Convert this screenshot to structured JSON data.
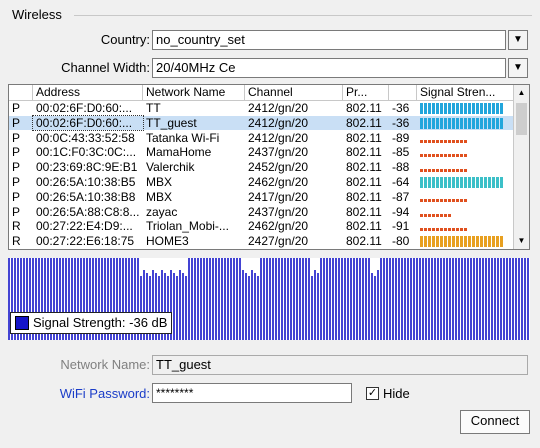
{
  "group": {
    "title": "Wireless"
  },
  "country": {
    "label": "Country:",
    "value": "no_country_set"
  },
  "channel_width": {
    "label": "Channel Width:",
    "value": "20/40MHz Ce"
  },
  "table": {
    "columns": [
      "",
      "Address",
      "Network Name",
      "Channel",
      "Pr...",
      "",
      "Signal Stren..."
    ],
    "rows": [
      {
        "type": "P",
        "address": "00:02:6F:D0:60:...",
        "network": "TT",
        "channel": "2412/gn/20",
        "protocol": "802.11",
        "signal": "-36",
        "selected": false,
        "bars": 100,
        "color": "#22a6dc"
      },
      {
        "type": "P",
        "address": "00:02:6F:D0:60:...",
        "network": "TT_guest",
        "channel": "2412/gn/20",
        "protocol": "802.11",
        "signal": "-36",
        "selected": true,
        "bars": 100,
        "color": "#22a6dc"
      },
      {
        "type": "P",
        "address": "00:0C:43:33:52:58",
        "network": "Tatanka Wi-Fi",
        "channel": "2412/gn/20",
        "protocol": "802.11",
        "signal": "-89",
        "selected": false,
        "bars": 55,
        "color": "#e0501e"
      },
      {
        "type": "P",
        "address": "00:1C:F0:3C:0C:...",
        "network": "MamaHome",
        "channel": "2437/gn/20",
        "protocol": "802.11",
        "signal": "-85",
        "selected": false,
        "bars": 55,
        "color": "#e0501e"
      },
      {
        "type": "P",
        "address": "00:23:69:8C:9E:B1",
        "network": "Valerchik",
        "channel": "2452/gn/20",
        "protocol": "802.11",
        "signal": "-88",
        "selected": false,
        "bars": 55,
        "color": "#e0501e"
      },
      {
        "type": "P",
        "address": "00:26:5A:10:38:B5",
        "network": "MBX",
        "channel": "2462/gn/20",
        "protocol": "802.11",
        "signal": "-64",
        "selected": false,
        "bars": 100,
        "color": "#3cc0c8"
      },
      {
        "type": "P",
        "address": "00:26:5A:10:38:B8",
        "network": "MBX",
        "channel": "2417/gn/20",
        "protocol": "802.11",
        "signal": "-87",
        "selected": false,
        "bars": 55,
        "color": "#e0501e"
      },
      {
        "type": "P",
        "address": "00:26:5A:88:C8:8...",
        "network": "zayac",
        "channel": "2437/gn/20",
        "protocol": "802.11",
        "signal": "-94",
        "selected": false,
        "bars": 40,
        "color": "#e0501e"
      },
      {
        "type": "R",
        "address": "00:27:22:E4:D9:...",
        "network": "Triolan_Mobi-...",
        "channel": "2462/gn/20",
        "protocol": "802.11",
        "signal": "-91",
        "selected": false,
        "bars": 55,
        "color": "#e0501e"
      },
      {
        "type": "R",
        "address": "00:27:22:E6:18:75",
        "network": "HOME3",
        "channel": "2427/gn/20",
        "protocol": "802.11",
        "signal": "-80",
        "selected": false,
        "bars": 100,
        "color": "#e8a020"
      }
    ]
  },
  "legend": {
    "label": "Signal Strength:",
    "value": "-36 dB",
    "color": "#1414c8"
  },
  "network_name": {
    "label": "Network Name:",
    "value": "TT_guest"
  },
  "wifi_password": {
    "label": "WiFi Password:",
    "value": "********"
  },
  "hide": {
    "label": "Hide",
    "checked": true
  },
  "connect": {
    "label": "Connect"
  }
}
